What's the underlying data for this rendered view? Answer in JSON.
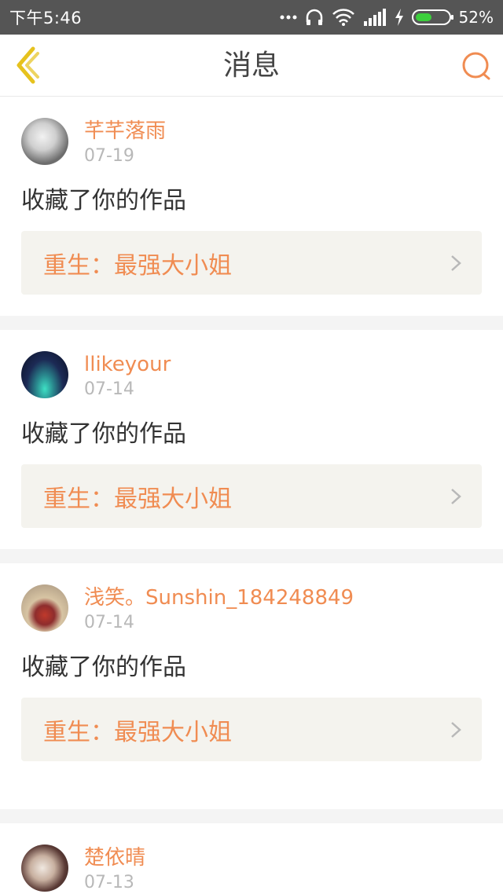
{
  "status_bar": {
    "time": "下午5:46",
    "battery": "52%",
    "battery_level": 0.52
  },
  "header": {
    "title": "消息"
  },
  "colors": {
    "accent": "#f08c52",
    "back_icon": "#e6c21e"
  },
  "messages": [
    {
      "username": "芊芊落雨",
      "date": "07-19",
      "action": "收藏了你的作品",
      "work_title": "重生：最强大小姐"
    },
    {
      "username": "llikeyour",
      "date": "07-14",
      "action": "收藏了你的作品",
      "work_title": "重生：最强大小姐"
    },
    {
      "username": "浅笑。Sunshin_184248849",
      "date": "07-14",
      "action": "收藏了你的作品",
      "work_title": "重生：最强大小姐"
    },
    {
      "username": "楚依晴",
      "date": "07-13"
    }
  ]
}
